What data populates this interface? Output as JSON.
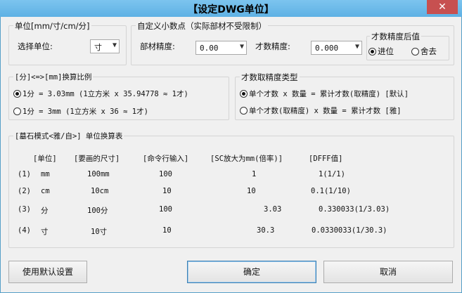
{
  "window": {
    "title": "【设定DWG单位】",
    "close_glyph": "✕"
  },
  "unit_group": {
    "legend": "单位[mm/寸/cm/分]",
    "select_label": "选择单位:",
    "unit_value": "寸"
  },
  "decimal_group": {
    "legend": "自定义小数点（实际部材不受限制）",
    "material_label": "部材精度:",
    "material_value": "0.00",
    "cai_label": "才数精度:",
    "cai_value": "0.000",
    "after_legend": "才数精度后值",
    "round_up": "进位",
    "round_off": "舍去"
  },
  "ratio_group": {
    "legend": "[分]<=>[mm]换算比例",
    "opt1": "1分 = 3.03mm (1立方米 x 35.94778 ≈ 1才)",
    "opt2": "1分 = 3mm (1立方米 x 36 ≈ 1才)"
  },
  "precision_group": {
    "legend": "才数取精度类型",
    "opt1": "单个才数 x 数量 = 累计才数(取精度) [默认]",
    "opt2": "单个才数(取精度) x 数量 = 累计才数 [雅]"
  },
  "table_group": {
    "legend": "[墓石模式<雅/自>] 单位换算表",
    "headers": [
      "[单位]",
      "[要画的尺寸]",
      "[命令行输入]",
      "[SC放大为mm(倍率)]",
      "[DFFF值]"
    ],
    "rows": [
      {
        "idx": "(1)",
        "unit": "mm",
        "size": "100mm",
        "input": "100",
        "scale": "1",
        "dfff": "1(1/1)"
      },
      {
        "idx": "(2)",
        "unit": "cm",
        "size": "10cm",
        "input": "10",
        "scale": "10",
        "dfff": "0.1(1/10)"
      },
      {
        "idx": "(3)",
        "unit": "分",
        "size": "100分",
        "input": "100",
        "scale": "3.03",
        "dfff": "0.330033(1/3.03)"
      },
      {
        "idx": "(4)",
        "unit": "寸",
        "size": "10寸",
        "input": "10",
        "scale": "30.3",
        "dfff": "0.0330033(1/30.3)"
      }
    ]
  },
  "buttons": {
    "defaults": "使用默认设置",
    "ok": "确定",
    "cancel": "取消"
  }
}
